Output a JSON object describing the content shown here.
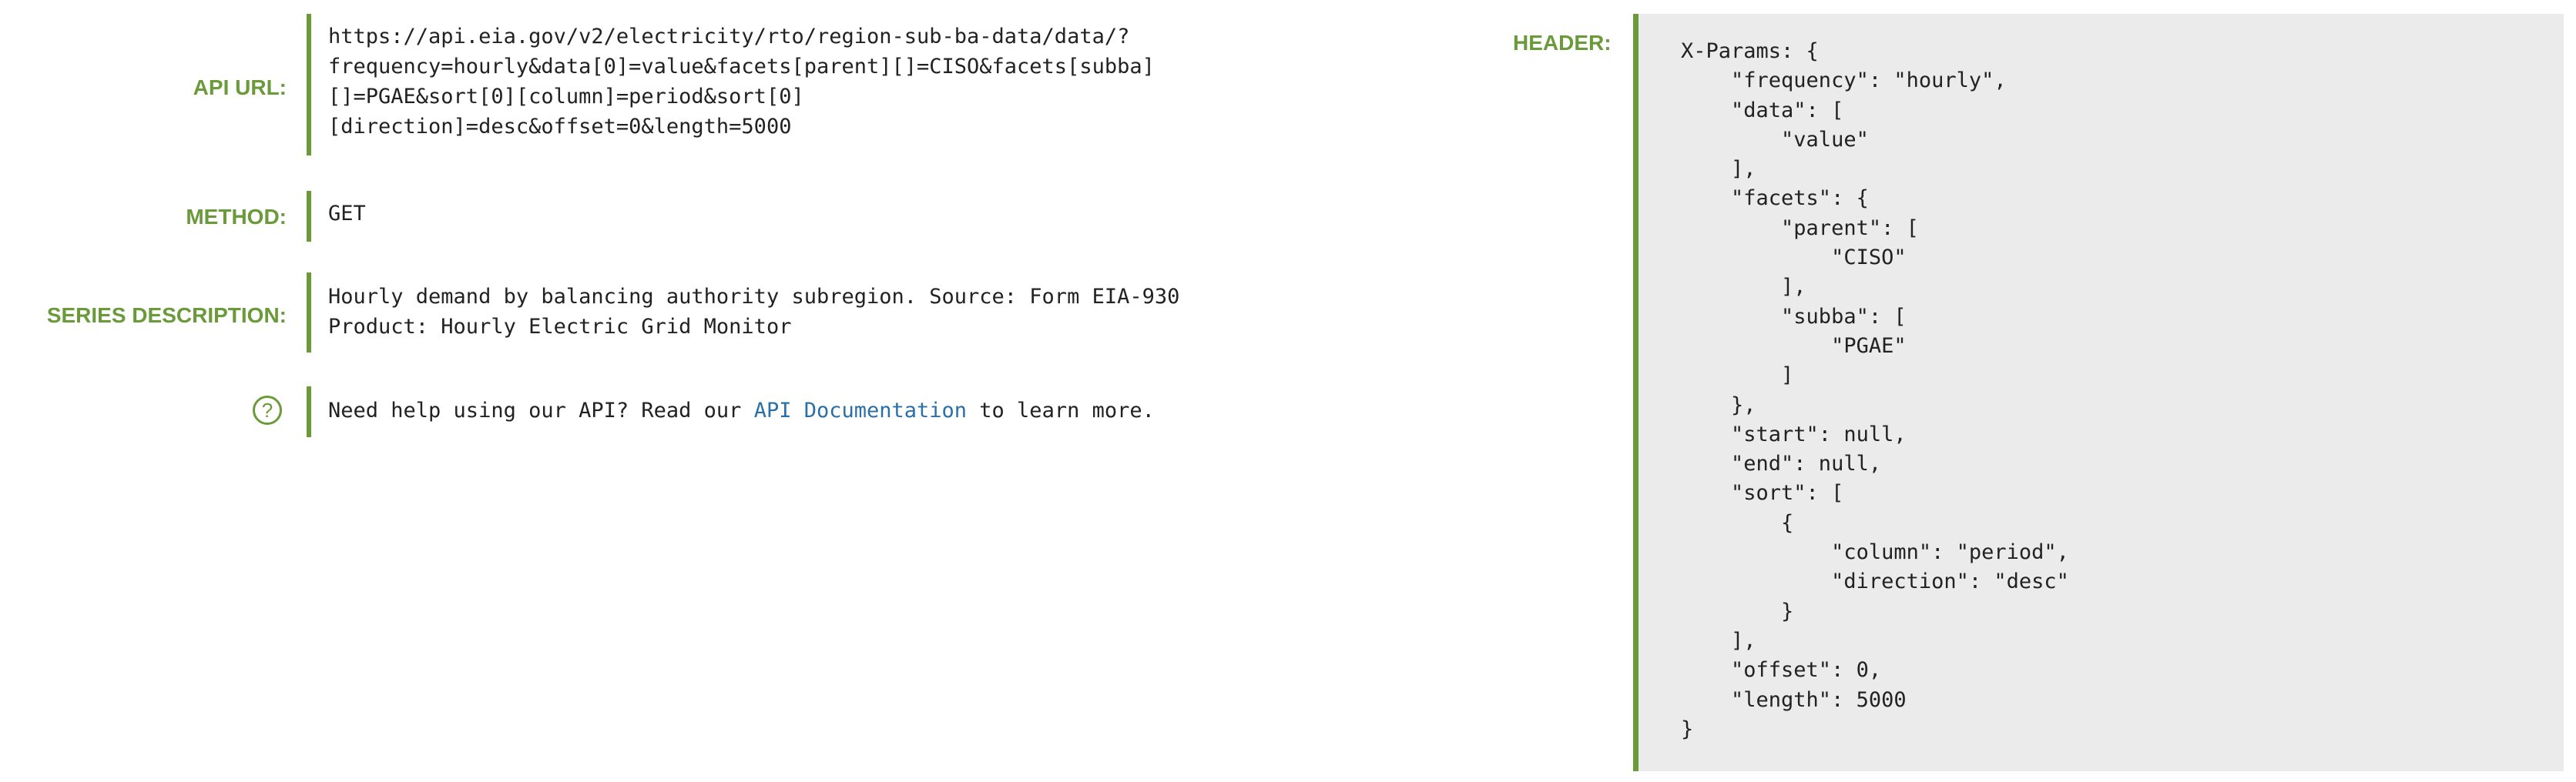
{
  "api_url": {
    "label": "API URL:",
    "value": "https://api.eia.gov/v2/electricity/rto/region-sub-ba-data/data/?\nfrequency=hourly&data[0]=value&facets[parent][]=CISO&facets[subba]\n[]=PGAE&sort[0][column]=period&sort[0]\n[direction]=desc&offset=0&length=5000"
  },
  "method": {
    "label": "METHOD:",
    "value": "GET"
  },
  "series_description": {
    "label": "SERIES DESCRIPTION:",
    "value": "Hourly demand by balancing authority subregion. Source: Form EIA-930\nProduct: Hourly Electric Grid Monitor"
  },
  "help": {
    "icon": "question-circle-icon",
    "icon_glyph": "?",
    "prefix": "Need help using our API? Read our ",
    "link_text": "API Documentation",
    "suffix": " to learn more."
  },
  "header": {
    "label": "HEADER:",
    "code": "X-Params: {\n    \"frequency\": \"hourly\",\n    \"data\": [\n        \"value\"\n    ],\n    \"facets\": {\n        \"parent\": [\n            \"CISO\"\n        ],\n        \"subba\": [\n            \"PGAE\"\n        ]\n    },\n    \"start\": null,\n    \"end\": null,\n    \"sort\": [\n        {\n            \"column\": \"period\",\n            \"direction\": \"desc\"\n        }\n    ],\n    \"offset\": 0,\n    \"length\": 5000\n}"
  },
  "colors": {
    "accent": "#6a9a3a",
    "link": "#2a6fa8",
    "panel_bg": "#ebebeb"
  }
}
